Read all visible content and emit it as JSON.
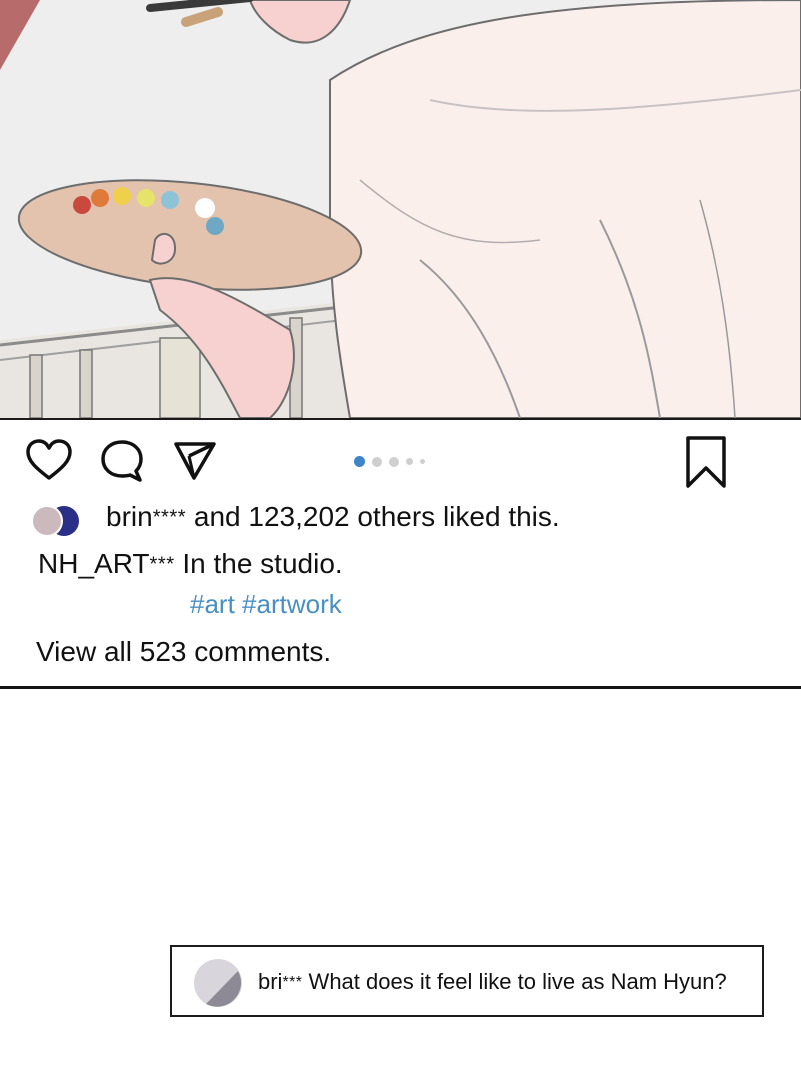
{
  "post": {
    "image": {
      "description_icon": "artist-painting-illustration",
      "colors": {
        "sky": "#eeeeee",
        "coat": "#fbefec",
        "palette": "#e3c2ae",
        "skin": "#f6d1cf",
        "curtain": "#b86b6b"
      }
    },
    "actions": {
      "like_icon": "heart-icon",
      "comment_icon": "speech-bubble-icon",
      "share_icon": "paper-plane-icon",
      "bookmark_icon": "bookmark-icon"
    },
    "carousel": {
      "total": 5,
      "active_index": 0,
      "active_color": "#3d84c8",
      "inactive_color": "#cfcfcf"
    },
    "likes": {
      "user": "brin",
      "user_stars": "****",
      "rest": " and 123,202 others liked this."
    },
    "caption": {
      "author": "NH_ART",
      "author_stars": "***",
      "text": " In the studio."
    },
    "hashtags": "#art #artwork",
    "view_comments": "View all 523 comments."
  },
  "comment": {
    "user": "bri",
    "user_stars": "***",
    "text": " What does it feel like to live as Nam Hyun?"
  }
}
